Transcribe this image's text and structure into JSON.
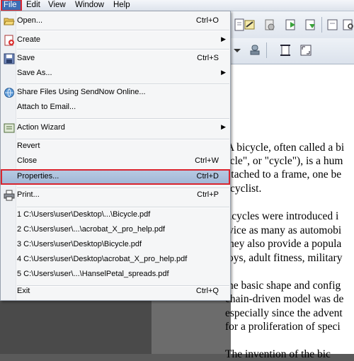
{
  "menubar": {
    "items": [
      "File",
      "Edit",
      "View",
      "Window",
      "Help"
    ]
  },
  "file_menu": {
    "open": {
      "label": "Open...",
      "shortcut": "Ctrl+O"
    },
    "create": {
      "label": "Create"
    },
    "save": {
      "label": "Save",
      "shortcut": "Ctrl+S"
    },
    "save_as": {
      "label": "Save As..."
    },
    "share": {
      "label": "Share Files Using SendNow Online..."
    },
    "attach": {
      "label": "Attach to Email..."
    },
    "action_wizard": {
      "label": "Action Wizard"
    },
    "revert": {
      "label": "Revert"
    },
    "close": {
      "label": "Close",
      "shortcut": "Ctrl+W"
    },
    "properties": {
      "label": "Properties...",
      "shortcut": "Ctrl+D"
    },
    "print": {
      "label": "Print...",
      "shortcut": "Ctrl+P"
    },
    "recent": [
      "1 C:\\Users\\user\\Desktop\\...\\Bicycle.pdf",
      "2 C:\\Users\\user\\...\\acrobat_X_pro_help.pdf",
      "3 C:\\Users\\user\\Desktop\\Bicycle.pdf",
      "4 C:\\Users\\user\\Desktop\\acrobat_X_pro_help.pdf",
      "5 C:\\Users\\user\\...\\HanselPetal_spreads.pdf"
    ],
    "exit": {
      "label": "Exit",
      "shortcut": "Ctrl+Q"
    }
  },
  "document": {
    "lines": [
      "A bicycle, often called a bi",
      "ycle\", or \"cycle\"), is a hum",
      "ttached to a frame, one be",
      "cyclist.",
      "icycles were introduced i",
      "vice as many as automobi",
      "hey also provide a popula",
      "oys, adult fitness, military",
      "he basic shape and config",
      "chain-driven model was de",
      "especially since the advent",
      "for a proliferation of speci",
      "The invention of the bic"
    ]
  },
  "colors": {
    "accent": "#3e6db5",
    "highlight_border": "#d9252f",
    "menu_bg": "#f5f6f7"
  }
}
